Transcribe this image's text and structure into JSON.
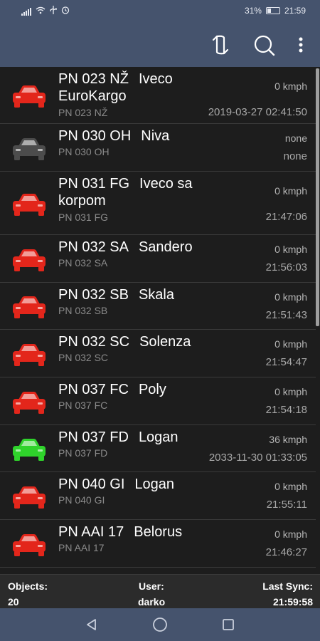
{
  "status_bar": {
    "battery_percent": "31%",
    "time": "21:59",
    "icons": [
      "signal-icon",
      "wifi-icon",
      "usb-icon",
      "alarm-icon",
      "battery-icon"
    ]
  },
  "toolbar": {
    "icons": [
      "sync-icon",
      "search-icon",
      "more-vert-icon"
    ]
  },
  "colors": {
    "toolbar": "#45536d",
    "car_red": "#e3261b",
    "car_green": "#2fd32b",
    "car_gray": "#4c4c4c"
  },
  "vehicles": [
    {
      "plate": "PN 023 NŽ",
      "name": "Iveco",
      "name2": "EuroKargo",
      "sub": "PN 023 NŽ",
      "speed": "0 kmph",
      "time": "2019-03-27 02:41:50",
      "status": "red"
    },
    {
      "plate": "PN 030 OH",
      "name": "Niva",
      "name2": "",
      "sub": "PN 030 OH",
      "speed": "none",
      "time": "none",
      "status": "gray"
    },
    {
      "plate": "PN 031 FG",
      "name": "Iveco sa",
      "name2": "korpom",
      "sub": "PN 031 FG",
      "speed": "0 kmph",
      "time": "21:47:06",
      "status": "red"
    },
    {
      "plate": "PN 032 SA",
      "name": "Sandero",
      "name2": "",
      "sub": "PN 032 SA",
      "speed": "0 kmph",
      "time": "21:56:03",
      "status": "red"
    },
    {
      "plate": "PN 032 SB",
      "name": "Skala",
      "name2": "",
      "sub": "PN 032 SB",
      "speed": "0 kmph",
      "time": "21:51:43",
      "status": "red"
    },
    {
      "plate": "PN 032 SC",
      "name": "Solenza",
      "name2": "",
      "sub": "PN 032 SC",
      "speed": "0 kmph",
      "time": "21:54:47",
      "status": "red"
    },
    {
      "plate": "PN 037 FC",
      "name": "Poly",
      "name2": "",
      "sub": "PN 037 FC",
      "speed": "0 kmph",
      "time": "21:54:18",
      "status": "red"
    },
    {
      "plate": "PN 037 FD",
      "name": "Logan",
      "name2": "",
      "sub": "PN 037 FD",
      "speed": "36 kmph",
      "time": "2033-11-30 01:33:05",
      "status": "green"
    },
    {
      "plate": "PN 040 GI",
      "name": "Logan",
      "name2": "",
      "sub": "PN 040 GI",
      "speed": "0 kmph",
      "time": "21:55:11",
      "status": "red"
    },
    {
      "plate": "PN AAI 17",
      "name": "Belorus",
      "name2": "",
      "sub": "PN AAI 17",
      "speed": "0 kmph",
      "time": "21:46:27",
      "status": "red"
    }
  ],
  "footer": {
    "objects_label": "Objects:",
    "objects_value": "20",
    "user_label": "User:",
    "user_value": "darko",
    "sync_label": "Last Sync:",
    "sync_value": "21:59:58"
  },
  "nav_bar": {
    "icons": [
      "back-icon",
      "home-icon",
      "recents-icon"
    ]
  }
}
